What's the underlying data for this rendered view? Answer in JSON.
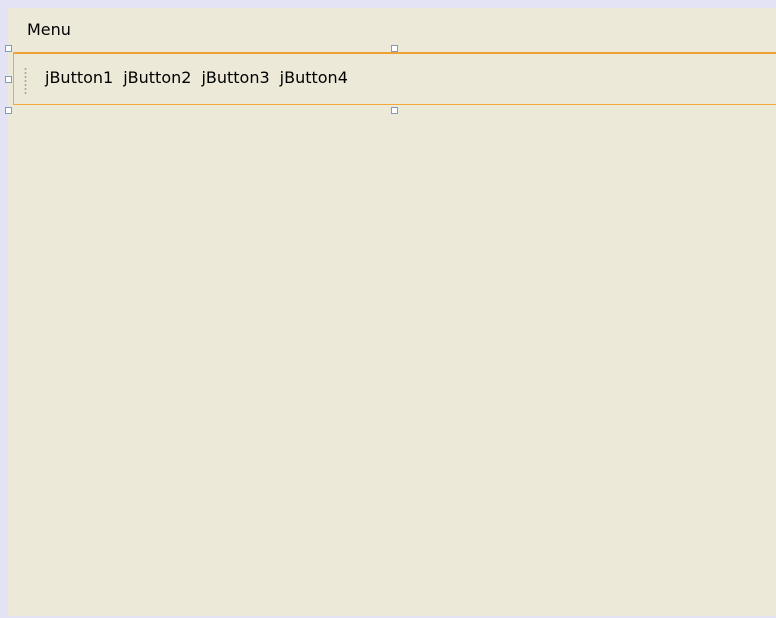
{
  "menu_bar": {
    "items": [
      {
        "label": "Menu"
      }
    ]
  },
  "toolbar": {
    "buttons": [
      {
        "label": "jButton1"
      },
      {
        "label": "jButton2"
      },
      {
        "label": "jButton3"
      },
      {
        "label": "jButton4"
      }
    ]
  },
  "colors": {
    "panel_background": "#ece9d8",
    "selection_border": "#f3a93a",
    "outer_frame": "#e3e3f5",
    "handle_border": "#7f9db9"
  }
}
